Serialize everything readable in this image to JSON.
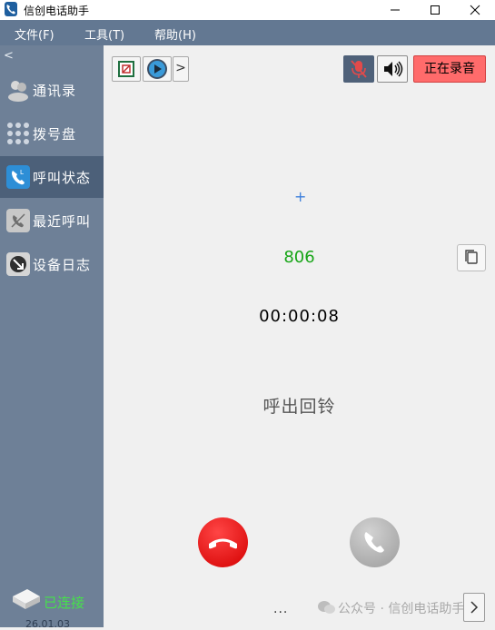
{
  "window": {
    "title": "信创电话助手"
  },
  "menu": [
    {
      "label": "文件(F)"
    },
    {
      "label": "工具(T)"
    },
    {
      "label": "帮助(H)"
    }
  ],
  "sidebar": {
    "items": [
      {
        "label": "通讯录",
        "icon": "contacts-icon"
      },
      {
        "label": "拨号盘",
        "icon": "dialpad-icon"
      },
      {
        "label": "呼叫状态",
        "icon": "call-status-icon",
        "active": true
      },
      {
        "label": "最近呼叫",
        "icon": "recent-calls-icon"
      },
      {
        "label": "设备日志",
        "icon": "device-log-icon"
      }
    ],
    "status": "已连接",
    "date": "26.01.03"
  },
  "toolbar": {
    "record_label": "正在录音",
    "mic_muted": true
  },
  "call": {
    "plus": "+",
    "number": "806",
    "timer": "00:00:08",
    "state": "呼出回铃"
  },
  "footer": {
    "dots": "...",
    "watermark": "公众号 · 信创电话助手"
  },
  "colors": {
    "menubar": "#637892",
    "sidebar": "#6e8097",
    "sidebar_active": "#4c6079",
    "record": "#ff6b6b",
    "number": "#17a517",
    "hangup": "#e00000",
    "connected": "#45e24a"
  }
}
